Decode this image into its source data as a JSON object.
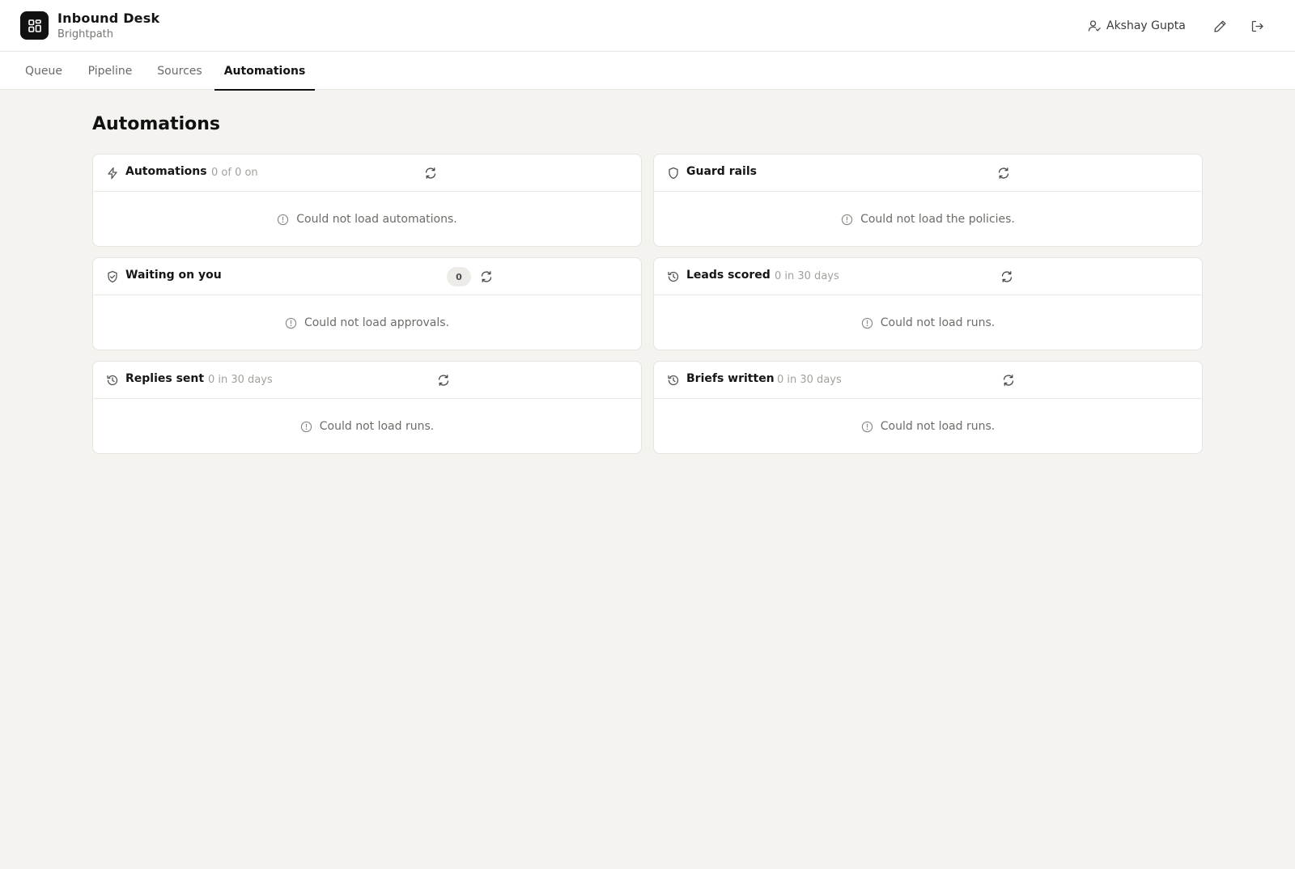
{
  "app": {
    "title": "Inbound Desk",
    "subtitle": "Brightpath",
    "logo_icon": "dashboard-grid-icon"
  },
  "user": {
    "name": "Akshay Gupta",
    "icon": "user-icon"
  },
  "header_actions": [
    {
      "name": "edit",
      "icon": "pencil-icon"
    },
    {
      "name": "sign-out",
      "icon": "logout-icon"
    }
  ],
  "tabs": [
    {
      "label": "Queue",
      "active": false
    },
    {
      "label": "Pipeline",
      "active": false
    },
    {
      "label": "Sources",
      "active": false
    },
    {
      "label": "Automations",
      "active": true
    }
  ],
  "page": {
    "title": "Automations"
  },
  "cards": [
    {
      "id": "automations",
      "title": "Automations",
      "meta": "0 of 0 on",
      "icon": "lightning-icon",
      "message": "Could not load automations."
    },
    {
      "id": "guard-rails",
      "title": "Guard rails",
      "meta": "",
      "icon": "shield-icon",
      "message": "Could not load the policies."
    },
    {
      "id": "waiting-on-you",
      "title": "Waiting on you",
      "meta": "",
      "badge": "0",
      "icon": "shield-check-icon",
      "message": "Could not load approvals."
    },
    {
      "id": "leads-scored",
      "title": "Leads scored",
      "meta": "0 in 30 days",
      "icon": "history-icon",
      "message": "Could not load runs."
    },
    {
      "id": "replies-sent",
      "title": "Replies sent",
      "meta": "0 in 30 days",
      "icon": "history-icon",
      "message": "Could not load runs."
    },
    {
      "id": "briefs-written",
      "title": "Briefs written",
      "meta": "0 in 30 days",
      "icon": "history-icon",
      "message": "Could not load runs."
    }
  ],
  "colors": {
    "background": "#f4f3f0",
    "surface": "#ffffff",
    "accent": "#111111",
    "muted_text": "#a3a19c"
  }
}
